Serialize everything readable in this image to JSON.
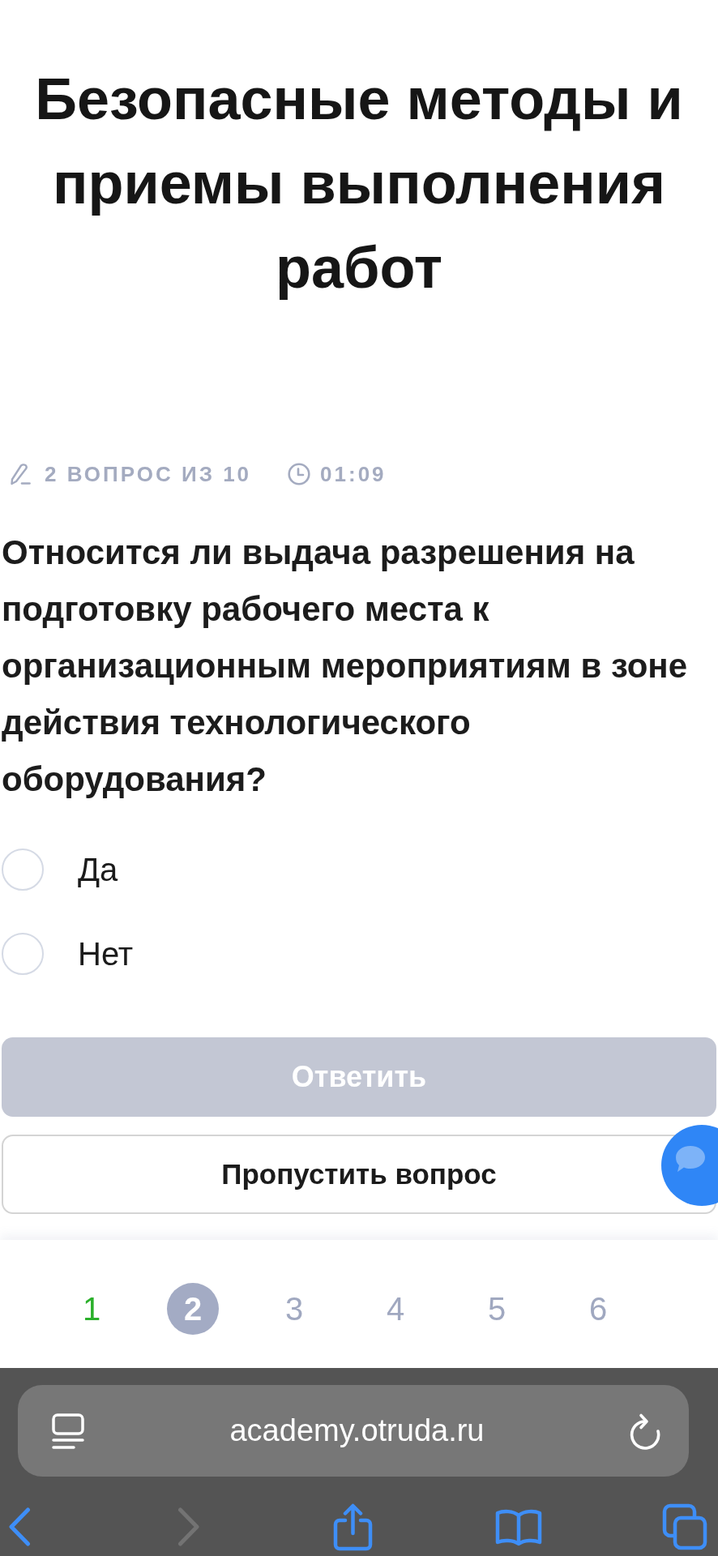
{
  "title": "Безопасные методы и приемы выполнения работ",
  "meta": {
    "progress": "2 ВОПРОС ИЗ 10",
    "timer": "01:09"
  },
  "question": {
    "text": "Относится ли выдача разрешения на подготовку рабочего места к организационным мероприятиям в зоне действия технологического оборудования?"
  },
  "options": [
    {
      "label": "Да",
      "selected": false
    },
    {
      "label": "Нет",
      "selected": false
    }
  ],
  "submit_button": {
    "label": "Ответить",
    "disabled": true
  },
  "skip_button": {
    "label": "Пропустить вопрос"
  },
  "pagination": [
    {
      "label": "1",
      "selected": false,
      "answered": true
    },
    {
      "label": "2",
      "selected": true,
      "answered": false
    },
    {
      "label": "3",
      "selected": false,
      "answered": false
    },
    {
      "label": "4",
      "selected": false,
      "answered": false
    },
    {
      "label": "5",
      "selected": false,
      "answered": false
    },
    {
      "label": "6",
      "selected": false,
      "answered": false
    }
  ],
  "browser": {
    "url": "academy.otruda.ru",
    "back_disabled": false,
    "forward_disabled": true
  }
}
